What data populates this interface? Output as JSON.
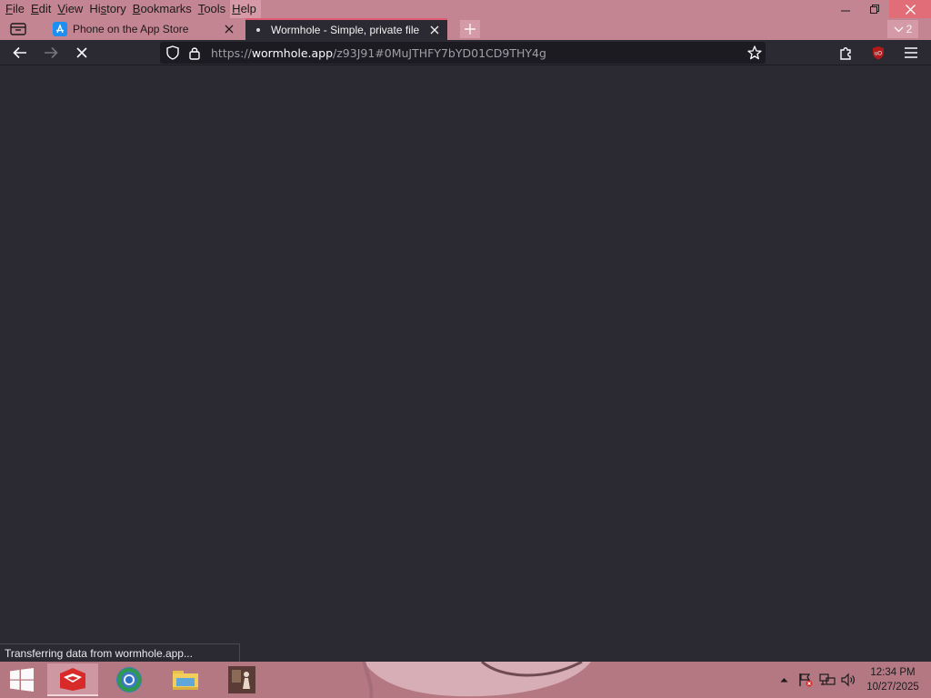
{
  "menubar": {
    "items": [
      {
        "label_u": "F",
        "label_rest": "ile"
      },
      {
        "label_u": "E",
        "label_rest": "dit"
      },
      {
        "label_u": "V",
        "label_rest": "iew"
      },
      {
        "label_pre": "Hi",
        "label_u": "s",
        "label_rest": "tory"
      },
      {
        "label_u": "B",
        "label_rest": "ookmarks"
      },
      {
        "label_u": "T",
        "label_rest": "ools"
      },
      {
        "label_u": "H",
        "label_rest": "elp"
      }
    ]
  },
  "tabs": [
    {
      "title": "Phone on the App Store",
      "icon": "app-store-icon",
      "active": false
    },
    {
      "title": "Wormhole - Simple, private file",
      "icon": "loading-dot-icon",
      "active": true
    }
  ],
  "tab_count": "2",
  "urlbar": {
    "scheme": "https://",
    "host": "wormhole.app",
    "path": "/z93J91#0MuJTHFY7bYD01CD9THY4g"
  },
  "status": {
    "text": "Transferring data from wormhole.app..."
  },
  "taskbar": {
    "apps": [
      "red-game-app-icon",
      "chrome-app-icon",
      "file-explorer-icon",
      "photo-app-icon"
    ]
  },
  "clock": {
    "time": "12:34 PM",
    "date": "10/27/2025"
  },
  "colors": {
    "chrome_pink": "#c48592",
    "content_bg": "#2b2a33",
    "active_tab_accent": "#e25a73",
    "taskbar": "#b47883"
  }
}
